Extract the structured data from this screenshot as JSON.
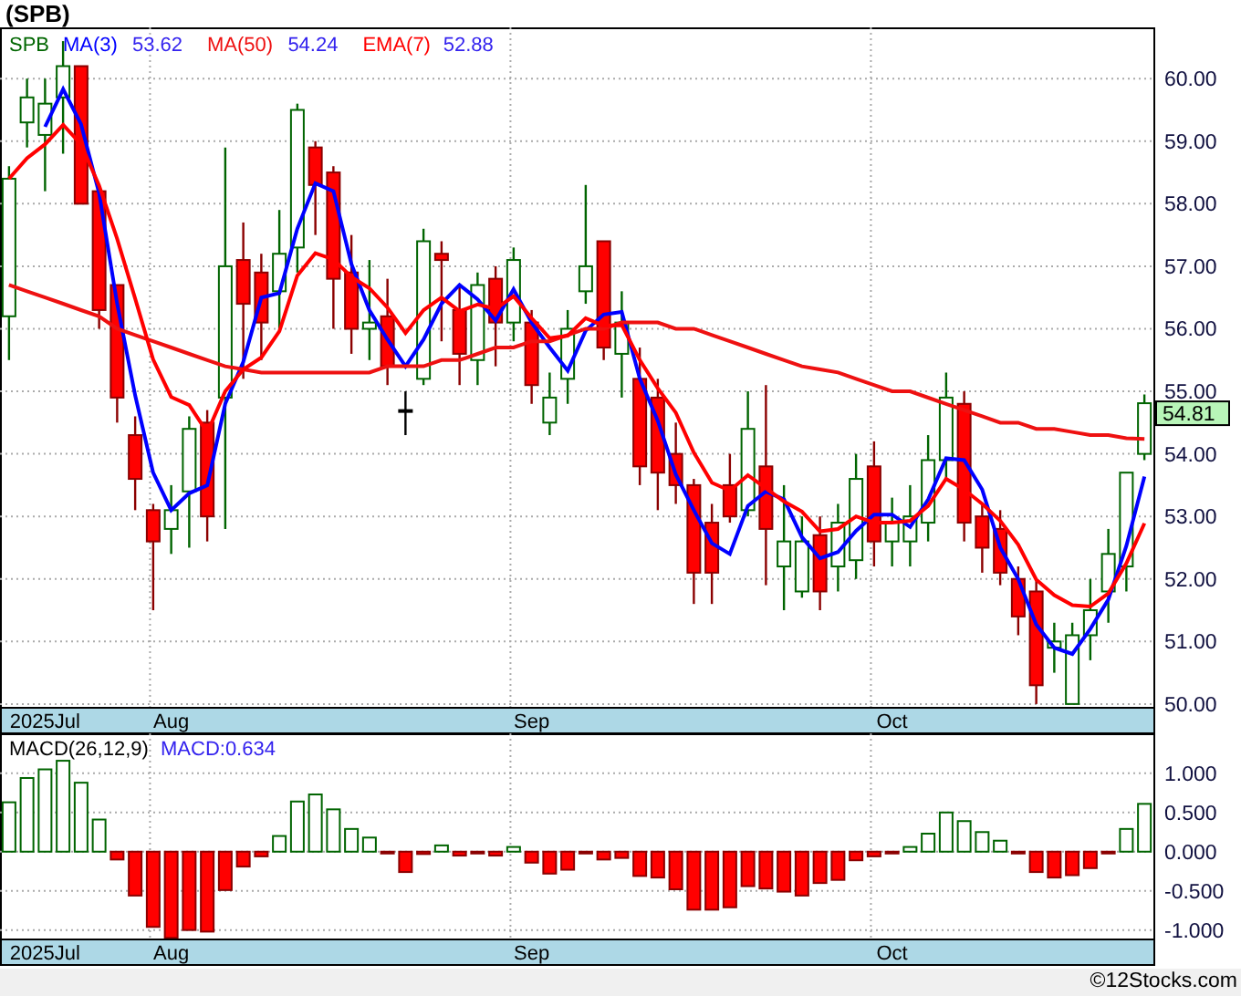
{
  "title": "(SPB)",
  "price_panel": {
    "legend": {
      "symbol": "SPB",
      "values": [
        "53.62",
        "54.24",
        "52.88"
      ]
    },
    "last_price": "54.81",
    "chart_data": {
      "type": "candlestick",
      "grid": true,
      "categories": [
        null,
        null,
        "2025Jul",
        null,
        null,
        null,
        null,
        null,
        null,
        "Aug",
        null,
        null,
        null,
        null,
        null,
        null,
        null,
        null,
        null,
        null,
        null,
        null,
        null,
        null,
        null,
        null,
        null,
        null,
        null,
        "Sep",
        null,
        null,
        null,
        null,
        null,
        null,
        null,
        null,
        null,
        null,
        null,
        null,
        null,
        null,
        null,
        null,
        null,
        null,
        null,
        "Oct",
        null,
        null,
        null,
        null,
        null,
        null,
        null,
        null,
        null,
        null,
        null,
        null,
        null,
        null
      ],
      "ylim": [
        49.94,
        60.82
      ],
      "yticks": [
        {
          "value": 50,
          "label": "50.00"
        },
        {
          "value": 51,
          "label": "51.00"
        },
        {
          "value": 52,
          "label": "52.00"
        },
        {
          "value": 53,
          "label": "53.00"
        },
        {
          "value": 54,
          "label": "54.00"
        },
        {
          "value": 55,
          "label": "55.00"
        },
        {
          "value": 56,
          "label": "56.00"
        },
        {
          "value": 57,
          "label": "57.00"
        },
        {
          "value": 58,
          "label": "58.00"
        },
        {
          "value": 59,
          "label": "59.00"
        },
        {
          "value": 60,
          "label": "60.00"
        }
      ],
      "ohlc": [
        [
          56.2,
          58.6,
          55.5,
          58.4
        ],
        [
          59.3,
          60.0,
          58.9,
          59.7
        ],
        [
          59.1,
          60.0,
          58.2,
          59.6
        ],
        [
          59.7,
          60.6,
          58.8,
          60.2
        ],
        [
          60.2,
          60.2,
          58.0,
          58.0
        ],
        [
          58.2,
          58.2,
          56.0,
          56.3
        ],
        [
          56.7,
          56.7,
          54.5,
          54.9
        ],
        [
          54.3,
          54.6,
          53.1,
          53.6
        ],
        [
          53.1,
          53.2,
          51.5,
          52.6
        ],
        [
          52.8,
          53.5,
          52.4,
          53.1
        ],
        [
          53.4,
          54.6,
          52.5,
          54.4
        ],
        [
          54.5,
          54.7,
          52.6,
          53.0
        ],
        [
          54.9,
          58.9,
          52.8,
          57.0
        ],
        [
          57.1,
          57.7,
          55.2,
          56.4
        ],
        [
          56.9,
          57.2,
          55.5,
          56.1
        ],
        [
          56.6,
          57.9,
          56.0,
          57.2
        ],
        [
          57.3,
          59.6,
          56.9,
          59.5
        ],
        [
          58.9,
          59.0,
          57.5,
          58.3
        ],
        [
          58.5,
          58.6,
          56.0,
          56.8
        ],
        [
          56.9,
          57.5,
          55.6,
          56.0
        ],
        [
          56.0,
          57.1,
          55.5,
          56.1
        ],
        [
          56.2,
          56.8,
          55.1,
          55.4
        ],
        [
          54.7,
          55.0,
          54.3,
          54.7
        ],
        [
          55.2,
          57.6,
          55.1,
          57.4
        ],
        [
          57.2,
          57.4,
          55.8,
          57.1
        ],
        [
          56.3,
          56.7,
          55.1,
          55.6
        ],
        [
          55.5,
          56.9,
          55.1,
          56.7
        ],
        [
          56.8,
          57.0,
          55.4,
          56.1
        ],
        [
          56.1,
          57.3,
          55.8,
          57.1
        ],
        [
          56.1,
          56.3,
          54.8,
          55.1
        ],
        [
          54.5,
          55.3,
          54.3,
          54.9
        ],
        [
          55.2,
          56.3,
          54.8,
          56.0
        ],
        [
          56.6,
          58.3,
          56.4,
          57.0
        ],
        [
          57.4,
          57.4,
          55.5,
          55.7
        ],
        [
          55.6,
          56.6,
          54.9,
          56.1
        ],
        [
          55.2,
          55.7,
          53.5,
          53.8
        ],
        [
          54.9,
          55.2,
          53.1,
          53.7
        ],
        [
          54.0,
          54.5,
          53.2,
          53.5
        ],
        [
          53.5,
          53.6,
          51.6,
          52.1
        ],
        [
          52.9,
          53.2,
          51.6,
          52.1
        ],
        [
          53.5,
          54.0,
          52.9,
          53.0
        ],
        [
          53.1,
          55.0,
          53.0,
          54.4
        ],
        [
          53.8,
          55.1,
          51.9,
          52.8
        ],
        [
          52.2,
          53.5,
          51.5,
          52.6
        ],
        [
          51.8,
          53.0,
          51.7,
          52.6
        ],
        [
          52.7,
          53.0,
          51.5,
          51.8
        ],
        [
          52.2,
          53.2,
          51.8,
          52.9
        ],
        [
          52.3,
          54.0,
          52.0,
          53.6
        ],
        [
          53.8,
          54.2,
          52.2,
          52.6
        ],
        [
          52.6,
          53.3,
          52.2,
          52.9
        ],
        [
          52.6,
          53.5,
          52.2,
          53.0
        ],
        [
          52.9,
          54.3,
          52.6,
          53.9
        ],
        [
          53.9,
          55.3,
          53.6,
          54.9
        ],
        [
          54.8,
          55.0,
          52.6,
          52.9
        ],
        [
          53.0,
          53.2,
          52.1,
          52.5
        ],
        [
          52.8,
          53.1,
          51.9,
          52.1
        ],
        [
          52.0,
          52.2,
          51.1,
          51.4
        ],
        [
          51.8,
          52.0,
          50.0,
          50.3
        ],
        [
          50.9,
          51.3,
          50.5,
          51.0
        ],
        [
          50.0,
          51.3,
          50.0,
          51.1
        ],
        [
          51.1,
          52.0,
          50.7,
          51.5
        ],
        [
          51.8,
          52.8,
          51.3,
          52.4
        ],
        [
          52.2,
          53.7,
          51.8,
          53.7
        ],
        [
          54.0,
          54.95,
          53.9,
          54.81
        ]
      ],
      "series": [
        {
          "name": "MA(3)",
          "type": "line",
          "color": "#0000ff",
          "values": [
            null,
            null,
            59.23,
            59.83,
            59.27,
            58.17,
            56.4,
            54.93,
            53.7,
            53.1,
            53.37,
            53.5,
            54.8,
            55.47,
            56.5,
            56.57,
            57.6,
            58.33,
            58.2,
            57.03,
            56.3,
            55.83,
            55.4,
            55.83,
            56.4,
            56.7,
            56.47,
            56.13,
            56.63,
            56.1,
            55.7,
            55.33,
            55.97,
            56.23,
            56.27,
            55.2,
            54.53,
            53.67,
            53.1,
            52.57,
            52.4,
            53.17,
            53.4,
            53.27,
            52.67,
            52.33,
            52.43,
            52.77,
            53.03,
            53.03,
            52.83,
            53.27,
            53.93,
            53.9,
            53.43,
            52.5,
            52.0,
            51.27,
            50.9,
            50.8,
            51.2,
            51.67,
            52.53,
            53.64
          ]
        },
        {
          "name": "MA(50)",
          "type": "line",
          "color": "#ee1111",
          "values": [
            56.7,
            56.6,
            56.5,
            56.4,
            56.3,
            56.2,
            56.0,
            55.9,
            55.8,
            55.7,
            55.6,
            55.5,
            55.4,
            55.35,
            55.3,
            55.3,
            55.3,
            55.3,
            55.3,
            55.3,
            55.3,
            55.4,
            55.4,
            55.4,
            55.5,
            55.5,
            55.6,
            55.7,
            55.7,
            55.8,
            55.8,
            55.9,
            56.0,
            56.0,
            56.1,
            56.1,
            56.1,
            56.0,
            56.0,
            55.9,
            55.8,
            55.7,
            55.6,
            55.5,
            55.4,
            55.35,
            55.3,
            55.2,
            55.1,
            55.0,
            55.0,
            54.9,
            54.8,
            54.7,
            54.6,
            54.5,
            54.5,
            54.4,
            54.4,
            54.35,
            54.3,
            54.3,
            54.25,
            54.24
          ]
        },
        {
          "name": "EMA(7)",
          "type": "line",
          "color": "#ff0000",
          "values": [
            58.4,
            58.73,
            58.95,
            59.26,
            58.95,
            58.29,
            57.44,
            56.48,
            55.51,
            54.91,
            54.78,
            54.34,
            55.0,
            55.35,
            55.54,
            55.96,
            56.85,
            57.21,
            57.11,
            56.83,
            56.65,
            56.34,
            55.93,
            56.3,
            56.5,
            56.28,
            56.39,
            56.32,
            56.52,
            56.17,
            55.85,
            55.89,
            56.17,
            56.05,
            56.06,
            55.5,
            55.05,
            54.66,
            54.02,
            53.54,
            53.41,
            53.66,
            53.45,
            53.24,
            53.08,
            52.76,
            52.8,
            53.0,
            52.9,
            52.9,
            52.93,
            53.17,
            53.6,
            53.43,
            53.2,
            52.93,
            52.55,
            51.99,
            51.74,
            51.58,
            51.56,
            51.77,
            52.25,
            52.89
          ]
        }
      ]
    }
  },
  "macd_panel": {
    "legend": {
      "label": "MACD(26,12,9)",
      "value": "MACD:0.634"
    },
    "chart_data": {
      "type": "bar",
      "grid": true,
      "categories": [
        null,
        null,
        "2025Jul",
        null,
        null,
        null,
        null,
        null,
        null,
        "Aug",
        null,
        null,
        null,
        null,
        null,
        null,
        null,
        null,
        null,
        null,
        null,
        null,
        null,
        null,
        null,
        null,
        null,
        null,
        null,
        "Sep",
        null,
        null,
        null,
        null,
        null,
        null,
        null,
        null,
        null,
        null,
        null,
        null,
        null,
        null,
        null,
        null,
        null,
        null,
        null,
        "Oct",
        null,
        null,
        null,
        null,
        null,
        null,
        null,
        null,
        null,
        null,
        null,
        null,
        null,
        null
      ],
      "ylim": [
        -1.12,
        1.51
      ],
      "yticks": [
        {
          "value": 1,
          "label": "1.000"
        },
        {
          "value": 0.5,
          "label": "0.500"
        },
        {
          "value": 0,
          "label": "0.000"
        },
        {
          "value": -0.5,
          "label": "-0.500"
        },
        {
          "value": -1,
          "label": "-1.000"
        }
      ],
      "values": [
        0.63,
        0.94,
        1.05,
        1.16,
        0.88,
        0.41,
        -0.1,
        -0.56,
        -0.96,
        -1.1,
        -1.0,
        -1.02,
        -0.49,
        -0.19,
        -0.06,
        0.2,
        0.64,
        0.73,
        0.54,
        0.29,
        0.18,
        -0.02,
        -0.26,
        -0.03,
        0.08,
        -0.05,
        -0.02,
        -0.05,
        0.06,
        -0.14,
        -0.28,
        -0.23,
        -0.02,
        -0.1,
        -0.08,
        -0.31,
        -0.33,
        -0.48,
        -0.74,
        -0.74,
        -0.71,
        -0.44,
        -0.47,
        -0.51,
        -0.56,
        -0.4,
        -0.36,
        -0.11,
        -0.06,
        -0.02,
        0.06,
        0.23,
        0.5,
        0.39,
        0.25,
        0.14,
        -0.02,
        -0.26,
        -0.33,
        -0.3,
        -0.21,
        -0.01,
        0.29,
        0.61
      ]
    }
  },
  "footer": "©12Stocks.com"
}
